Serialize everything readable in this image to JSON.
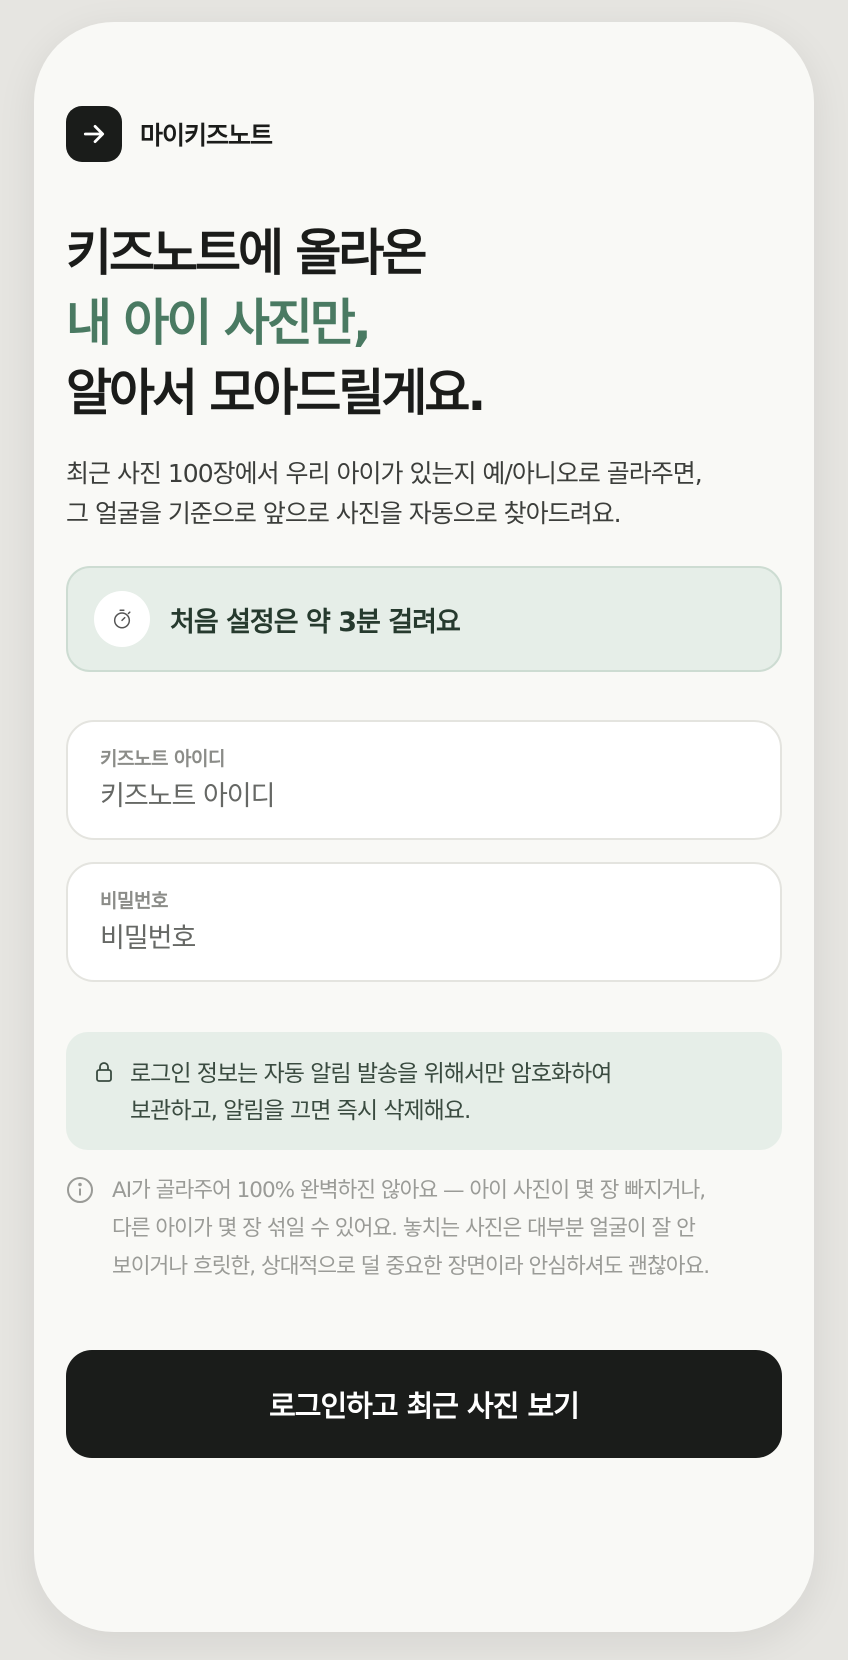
{
  "brand": {
    "name": "마이키즈노트",
    "icon": "arrow-right-icon"
  },
  "headline": {
    "line1": "키즈노트에 올라온",
    "line2": "내 아이 사진만,",
    "line3": "알아서 모아드릴게요."
  },
  "description": {
    "line1": "최근 사진 100장에서 우리 아이가 있는지 예/아니오로 골라주면,",
    "line2": "그 얼굴을 기준으로 앞으로 사진을 자동으로 찾아드려요."
  },
  "setup_notice": {
    "icon": "stopwatch-icon",
    "text": "처음 설정은 약 3분 걸려요"
  },
  "fields": {
    "id": {
      "label": "키즈노트 아이디",
      "placeholder": "키즈노트 아이디",
      "value": ""
    },
    "password": {
      "label": "비밀번호",
      "placeholder": "비밀번호",
      "value": ""
    }
  },
  "privacy": {
    "icon": "lock-icon",
    "line1": "로그인 정보는 자동 알림 발송을 위해서만 암호화하여",
    "line2": "보관하고, 알림을 끄면 즉시 삭제해요."
  },
  "disclaimer": {
    "icon": "info-icon",
    "line1": "AI가 골라주어 100% 완벽하진 않아요 — 아이 사진이 몇 장 빠지거나,",
    "line2": "다른 아이가 몇 장 섞일 수 있어요. 놓치는 사진은 대부분 얼굴이 잘 안",
    "line3": "보이거나 흐릿한, 상대적으로 덜 중요한 장면이라 안심하셔도 괜찮아요."
  },
  "cta": {
    "label": "로그인하고 최근 사진 보기"
  },
  "colors": {
    "accent": "#4a7a62",
    "dark": "#1a1c1a",
    "notice_bg": "#e6eee8",
    "page_bg": "#f9f9f6"
  }
}
